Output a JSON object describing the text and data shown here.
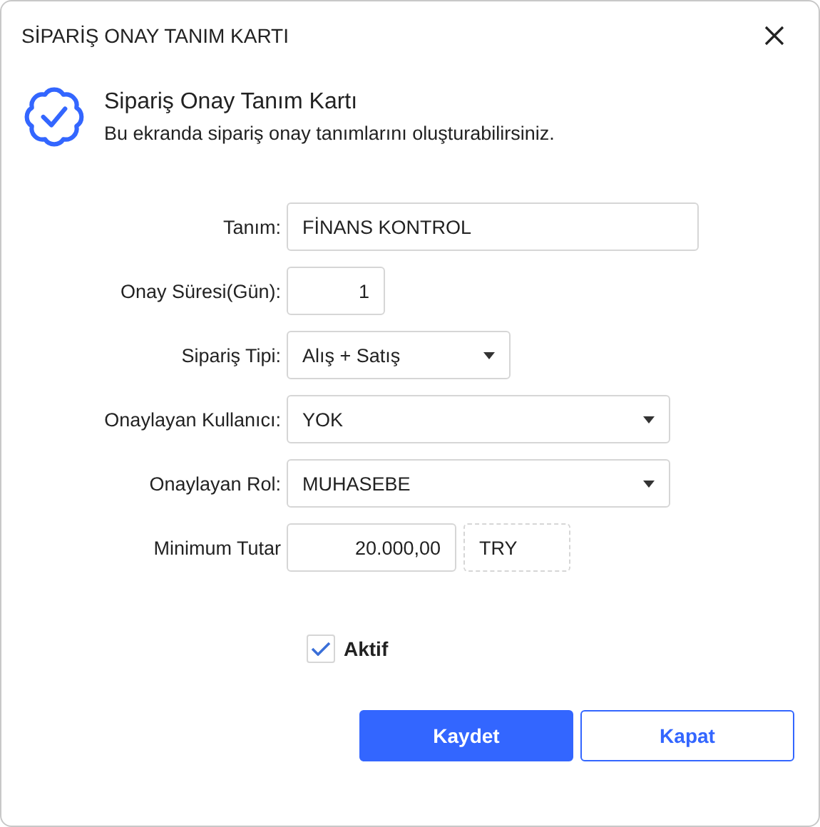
{
  "window": {
    "title": "SİPARİŞ ONAY TANIM KARTI"
  },
  "header": {
    "title": "Sipariş Onay Tanım Kartı",
    "subtitle": "Bu ekranda sipariş onay tanımlarını oluşturabilirsiniz."
  },
  "fields": [
    {
      "kind": "text",
      "label": "Tanım:",
      "value": "FİNANS KONTROL"
    },
    {
      "kind": "number",
      "label": "Onay Süresi(Gün):",
      "value": "1"
    },
    {
      "kind": "compact-select",
      "label": "Sipariş Tipi:",
      "value": "Alış + Satış"
    },
    {
      "kind": "select",
      "label": "Onaylayan Kullanıcı:",
      "value": "YOK"
    },
    {
      "kind": "select",
      "label": "Onaylayan Rol:",
      "value": "MUHASEBE"
    },
    {
      "kind": "money",
      "label": "Minimum Tutar",
      "value": "20.000,00",
      "currency": "TRY"
    }
  ],
  "active": {
    "label": "Aktif",
    "checked": true
  },
  "buttons": [
    {
      "kind": "primary",
      "label": "Kaydet"
    },
    {
      "kind": "secondary",
      "label": "Kapat"
    }
  ]
}
